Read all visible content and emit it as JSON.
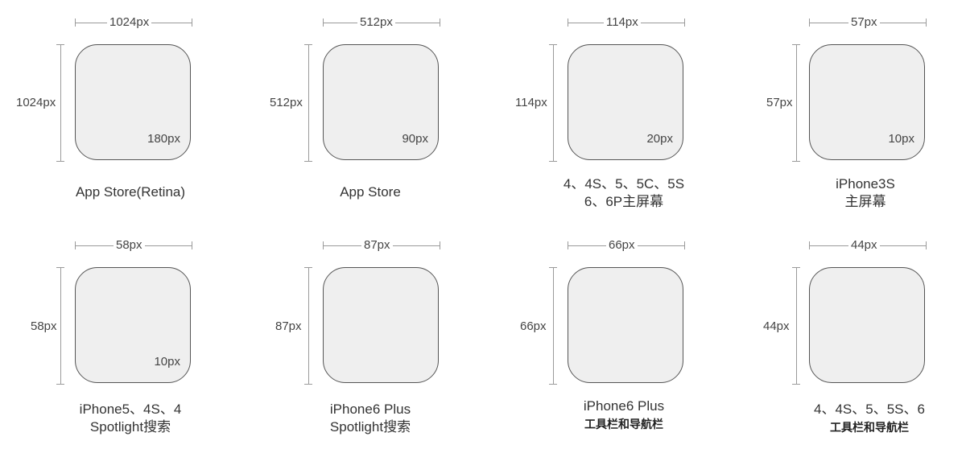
{
  "icons": [
    {
      "width_label": "1024px",
      "height_label": "1024px",
      "radius_label": "180px",
      "caption_line1": "App Store(Retina)",
      "caption_line2": "",
      "caption2_small": false
    },
    {
      "width_label": "512px",
      "height_label": "512px",
      "radius_label": "90px",
      "caption_line1": "App Store",
      "caption_line2": "",
      "caption2_small": false
    },
    {
      "width_label": "114px",
      "height_label": "114px",
      "radius_label": "20px",
      "caption_line1": "4、4S、5、5C、5S",
      "caption_line2": "6、6P主屏幕",
      "caption2_small": false
    },
    {
      "width_label": "57px",
      "height_label": "57px",
      "radius_label": "10px",
      "caption_line1": "iPhone3S",
      "caption_line2": "主屏幕",
      "caption2_small": false
    },
    {
      "width_label": "58px",
      "height_label": "58px",
      "radius_label": "10px",
      "caption_line1": "iPhone5、4S、4",
      "caption_line2": "Spotlight搜索",
      "caption2_small": false
    },
    {
      "width_label": "87px",
      "height_label": "87px",
      "radius_label": "",
      "caption_line1": "iPhone6 Plus",
      "caption_line2": "Spotlight搜索",
      "caption2_small": false
    },
    {
      "width_label": "66px",
      "height_label": "66px",
      "radius_label": "",
      "caption_line1": "iPhone6 Plus",
      "caption_line2": "工具栏和导航栏",
      "caption2_small": true
    },
    {
      "width_label": "44px",
      "height_label": "44px",
      "radius_label": "",
      "caption_line1": "4、4S、5、5S、6",
      "caption_line2": "工具栏和导航栏",
      "caption2_small": true
    }
  ]
}
